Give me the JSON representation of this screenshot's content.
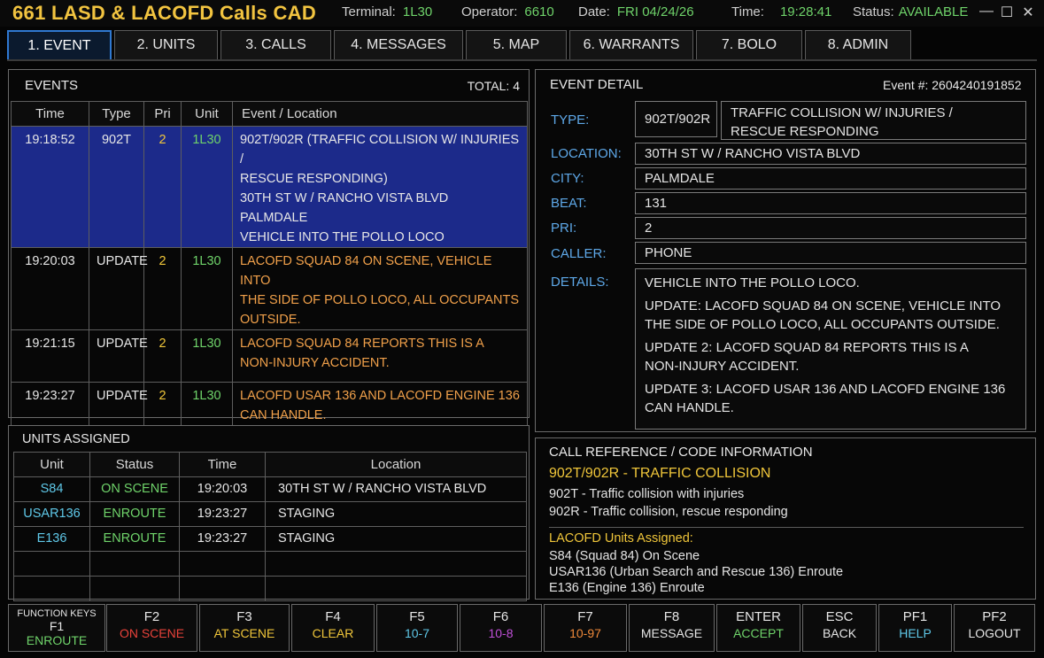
{
  "header": {
    "app_title": "661 LASD & LACOFD Calls CAD",
    "terminal_label": "Terminal:",
    "terminal_value": "1L30",
    "operator_label": "Operator:",
    "operator_value": "6610",
    "date_label": "Date:",
    "date_value": "FRI 04/24/26",
    "time_label": "Time:",
    "time_value": "19:28:41",
    "status_label": "Status:",
    "status_value": "AVAILABLE",
    "minimize": "—",
    "maximize": "☐",
    "close": "✕"
  },
  "tabs": [
    {
      "label": "1. EVENT",
      "active": true
    },
    {
      "label": "2. UNITS"
    },
    {
      "label": "3. CALLS"
    },
    {
      "label": "4. MESSAGES"
    },
    {
      "label": "5. MAP"
    },
    {
      "label": "6. WARRANTS"
    },
    {
      "label": "7. BOLO"
    },
    {
      "label": "8. ADMIN"
    }
  ],
  "events": {
    "title": "EVENTS",
    "total": "TOTAL: 4",
    "columns": [
      "Time",
      "Type",
      "Pri",
      "Unit",
      "Event / Location"
    ],
    "rows": [
      {
        "time": "19:18:52",
        "type": "902T",
        "pri": "2",
        "unit": "1L30",
        "lines": [
          "902T/902R (TRAFFIC COLLISION W/ INJURIES /",
          "RESCUE RESPONDING)",
          "30TH ST W / RANCHO VISTA BLVD",
          "PALMDALE",
          "VEHICLE INTO THE POLLO LOCO"
        ]
      },
      {
        "time": "19:20:03",
        "type": "UPDATE",
        "pri": "2",
        "unit": "1L30",
        "lines": [
          "LACOFD SQUAD 84 ON SCENE, VEHICLE INTO",
          "THE SIDE OF POLLO LOCO, ALL OCCUPANTS",
          "OUTSIDE."
        ]
      },
      {
        "time": "19:21:15",
        "type": "UPDATE",
        "pri": "2",
        "unit": "1L30",
        "lines": [
          "LACOFD SQUAD 84 REPORTS THIS IS A",
          "NON-INJURY ACCIDENT."
        ]
      },
      {
        "time": "19:23:27",
        "type": "UPDATE",
        "pri": "2",
        "unit": "1L30",
        "lines": [
          "LACOFD USAR 136 AND LACOFD ENGINE 136",
          "CAN HANDLE."
        ]
      }
    ]
  },
  "units": {
    "title": "UNITS ASSIGNED",
    "columns": [
      "Unit",
      "Status",
      "Time",
      "Location"
    ],
    "rows": [
      {
        "unit": "S84",
        "status": "ON SCENE",
        "time": "19:20:03",
        "location": "30TH ST W / RANCHO VISTA BLVD"
      },
      {
        "unit": "USAR136",
        "status": "ENROUTE",
        "time": "19:23:27",
        "location": "STAGING"
      },
      {
        "unit": "E136",
        "status": "ENROUTE",
        "time": "19:23:27",
        "location": "STAGING"
      }
    ]
  },
  "detail": {
    "title": "EVENT DETAIL",
    "event_number": "Event #: 2604240191852",
    "type_label": "TYPE:",
    "type_code": "902T/902R",
    "type_desc_1": "TRAFFIC COLLISION W/ INJURIES /",
    "type_desc_2": "RESCUE RESPONDING",
    "location_label": "LOCATION:",
    "location": "30TH ST W / RANCHO VISTA BLVD",
    "city_label": "CITY:",
    "city": "PALMDALE",
    "beat_label": "BEAT:",
    "beat": "131",
    "pri_label": "PRI:",
    "pri": "2",
    "caller_label": "CALLER:",
    "caller": "PHONE",
    "details_label": "DETAILS:",
    "details": [
      [
        "VEHICLE INTO THE POLLO LOCO."
      ],
      [
        "UPDATE: LACOFD SQUAD 84 ON SCENE, VEHICLE INTO",
        "THE SIDE OF POLLO LOCO, ALL OCCUPANTS OUTSIDE."
      ],
      [
        "UPDATE 2: LACOFD SQUAD 84 REPORTS THIS IS A",
        "NON-INJURY ACCIDENT."
      ],
      [
        "UPDATE 3: LACOFD USAR 136 AND LACOFD ENGINE 136",
        "CAN HANDLE."
      ]
    ]
  },
  "reference": {
    "title": "CALL REFERENCE / CODE INFORMATION",
    "code_heading": "902T/902R - TRAFFIC COLLISION",
    "code_lines": [
      "902T - Traffic collision with injuries",
      "902R - Traffic collision, rescue responding"
    ],
    "units_heading": "LACOFD Units Assigned:",
    "units_lines": [
      "S84 (Squad 84) On Scene",
      "USAR136 (Urban Search and Rescue 136) Enroute",
      "E136 (Engine 136) Enroute"
    ]
  },
  "function_keys": {
    "caption": "FUNCTION KEYS",
    "keys": [
      {
        "key": "F1",
        "action": "ENROUTE",
        "color": "#6fd36a"
      },
      {
        "key": "F2",
        "action": "ON SCENE",
        "color": "#e8423a"
      },
      {
        "key": "F3",
        "action": "AT SCENE",
        "color": "#f0c63a"
      },
      {
        "key": "F4",
        "action": "CLEAR",
        "color": "#f0c63a"
      },
      {
        "key": "F5",
        "action": "10-7",
        "color": "#5fc8e8"
      },
      {
        "key": "F6",
        "action": "10-8",
        "color": "#c050d8"
      },
      {
        "key": "F7",
        "action": "10-97",
        "color": "#f08a3a"
      },
      {
        "key": "F8",
        "action": "MESSAGE",
        "color": "#e6e6e6"
      },
      {
        "key": "ENTER",
        "action": "ACCEPT",
        "color": "#6fd36a"
      },
      {
        "key": "ESC",
        "action": "BACK",
        "color": "#e6e6e6"
      },
      {
        "key": "PF1",
        "action": "HELP",
        "color": "#5fc8e8"
      },
      {
        "key": "PF2",
        "action": "LOGOUT",
        "color": "#e6e6e6"
      }
    ]
  }
}
